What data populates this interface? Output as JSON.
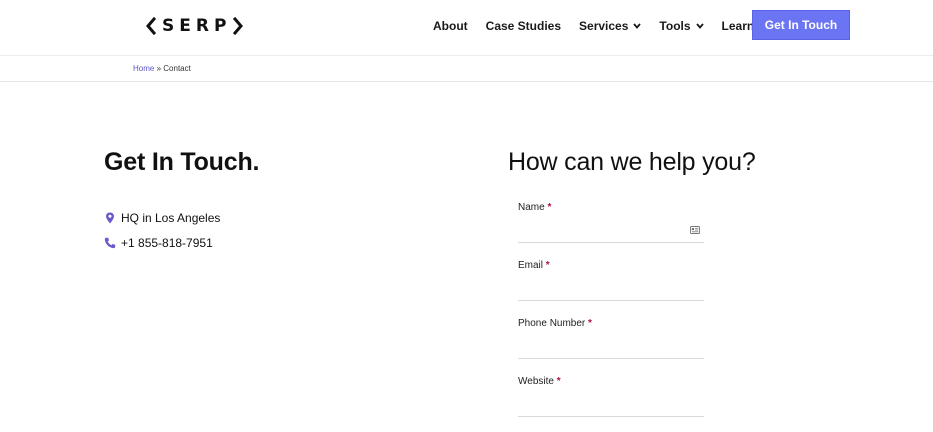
{
  "header": {
    "logo_text": "SERP",
    "nav": [
      {
        "label": "About",
        "has_dropdown": false
      },
      {
        "label": "Case Studies",
        "has_dropdown": false
      },
      {
        "label": "Services",
        "has_dropdown": true
      },
      {
        "label": "Tools",
        "has_dropdown": true
      },
      {
        "label": "Learn",
        "has_dropdown": true
      }
    ],
    "cta_label": "Get In Touch"
  },
  "breadcrumb": {
    "home": "Home",
    "separator": "»",
    "current": "Contact"
  },
  "left": {
    "title": "Get In Touch.",
    "location": "HQ in Los Angeles",
    "phone": "+1 855-818-7951"
  },
  "form": {
    "title": "How can we help you?",
    "required_mark": "*",
    "fields": [
      {
        "label": "Name",
        "value": ""
      },
      {
        "label": "Email",
        "value": ""
      },
      {
        "label": "Phone Number",
        "value": ""
      },
      {
        "label": "Website",
        "value": ""
      }
    ]
  },
  "colors": {
    "accent": "#6b74f3",
    "link": "#5b57c7",
    "icon": "#6a5acd",
    "required": "#b0163a"
  }
}
